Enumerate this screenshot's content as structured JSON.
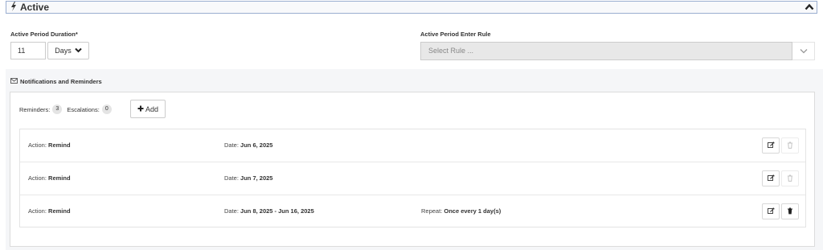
{
  "section": {
    "title": "Active"
  },
  "duration": {
    "label": "Active Period Duration*",
    "value": "11",
    "unit": "Days"
  },
  "enter_rule": {
    "label": "Active Period Enter Rule",
    "placeholder": "Select Rule ..."
  },
  "notifications": {
    "title": "Notifications and Reminders",
    "reminders_label": "Reminders:",
    "reminders_count": "3",
    "escalations_label": "Escalations:",
    "escalations_count": "0",
    "add_label": "Add"
  },
  "rows": [
    {
      "action_label": "Action:",
      "action": "Remind",
      "date_label": "Date:",
      "date": "Jun 6, 2025",
      "repeat_label": "",
      "repeat": "",
      "delete_enabled": false
    },
    {
      "action_label": "Action:",
      "action": "Remind",
      "date_label": "Date:",
      "date": "Jun 7, 2025",
      "repeat_label": "",
      "repeat": "",
      "delete_enabled": false
    },
    {
      "action_label": "Action:",
      "action": "Remind",
      "date_label": "Date:",
      "date": "Jun 8, 2025 - Jun 16, 2025",
      "repeat_label": "Repeat:",
      "repeat": "Once every 1 day(s)",
      "delete_enabled": true
    }
  ],
  "icons": {
    "section": "bolt-icon",
    "collapse": "chevron-up-icon",
    "notifications": "envelope-icon",
    "add": "plus-icon",
    "edit": "edit-icon",
    "delete": "trash-icon"
  }
}
